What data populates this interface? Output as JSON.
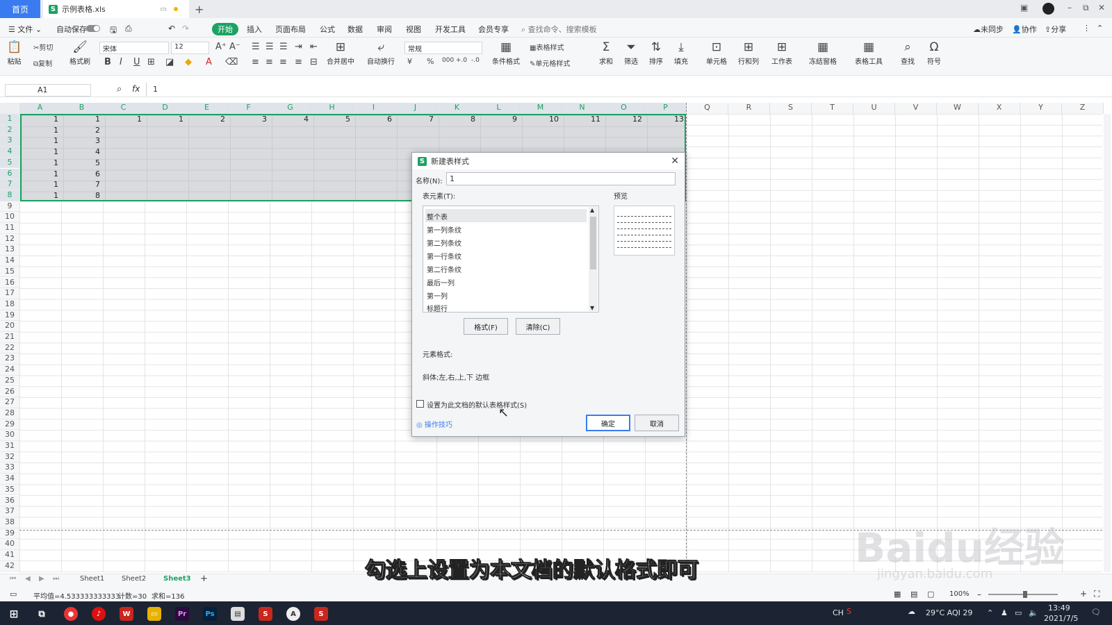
{
  "window": {
    "home_tab": "首页",
    "doc_tab": "示例表格.xls",
    "new_tab": "+",
    "min": "–",
    "restore": "⧉",
    "close": "✕"
  },
  "menubar": {
    "file": "文件",
    "autosave": "自动保存",
    "items": [
      "开始",
      "插入",
      "页面布局",
      "公式",
      "数据",
      "审阅",
      "视图",
      "开发工具",
      "会员专享"
    ],
    "search_placeholder": "查找命令、搜索模板",
    "sync": "未同步",
    "collab": "协作",
    "share": "分享"
  },
  "ribbon": {
    "paste": "粘贴",
    "cut": "剪切",
    "copy": "复制",
    "format_painter": "格式刷",
    "font_name": "宋体",
    "font_size": "12",
    "merge": "合并居中",
    "wrap": "自动换行",
    "number_format": "常规",
    "table_style": "表格样式",
    "cond_format": "条件格式",
    "cell_style": "单元格样式",
    "sum": "求和",
    "filter": "筛选",
    "sort": "排序",
    "fill": "填充",
    "cell": "单元格",
    "rowcol": "行和列",
    "sheet": "工作表",
    "freeze": "冻结窗格",
    "table_tools": "表格工具",
    "find": "查找",
    "symbol": "符号"
  },
  "formula": {
    "cell_ref": "A1",
    "fx": "fx",
    "value": "1"
  },
  "columns": [
    "A",
    "B",
    "C",
    "D",
    "E",
    "F",
    "G",
    "H",
    "I",
    "J",
    "K",
    "L",
    "M",
    "N",
    "O",
    "P",
    "Q",
    "R",
    "S",
    "T",
    "U",
    "V",
    "W",
    "X",
    "Y",
    "Z"
  ],
  "rows": [
    "1",
    "2",
    "3",
    "4",
    "5",
    "6",
    "7",
    "8",
    "9",
    "10",
    "11",
    "12",
    "13",
    "14",
    "15",
    "16",
    "17",
    "18",
    "19",
    "20",
    "21",
    "22",
    "23",
    "24",
    "25",
    "26",
    "27",
    "28",
    "29",
    "30",
    "31",
    "32",
    "33",
    "34",
    "35",
    "36",
    "37",
    "38",
    "39",
    "40",
    "41",
    "42"
  ],
  "cells": {
    "row1": [
      "1",
      "1",
      "1",
      "1",
      "2",
      "3",
      "4",
      "5",
      "6",
      "7",
      "8",
      "9",
      "10",
      "11",
      "12",
      "13"
    ],
    "colA": [
      "1",
      "1",
      "1",
      "1",
      "1",
      "1",
      "1"
    ],
    "colB": [
      "2",
      "3",
      "4",
      "5",
      "6",
      "7",
      "8"
    ]
  },
  "dialog": {
    "title": "新建表样式",
    "name_label": "名称(N):",
    "name_value": "1",
    "elements_label": "表元素(T):",
    "preview_label": "预览",
    "elements": [
      "整个表",
      "第一列条纹",
      "第二列条纹",
      "第一行条纹",
      "第二行条纹",
      "最后一列",
      "第一列",
      "标题行"
    ],
    "format_button": "格式(F)",
    "clear_button": "清除(C)",
    "element_format_label": "元素格式:",
    "element_format_value": "斜体;左,右,上,下 边框",
    "default_checkbox": "设置为此文档的默认表格样式(S)",
    "tips": "操作技巧",
    "ok": "确定",
    "cancel": "取消"
  },
  "sheets": [
    "Sheet1",
    "Sheet2",
    "Sheet3"
  ],
  "status": {
    "average": "平均值=4.533333333333",
    "count": "计数=30",
    "sum": "求和=136",
    "zoom": "100%"
  },
  "caption": "勾选上设置为本文档的默认格式即可",
  "watermark": "Baidu经验",
  "watermark_sub": "jingyan.baidu.com",
  "taskbar": {
    "weather": "29°C AQI 29",
    "time": "13:49",
    "date": "2021/7/5",
    "lang": "CH"
  }
}
